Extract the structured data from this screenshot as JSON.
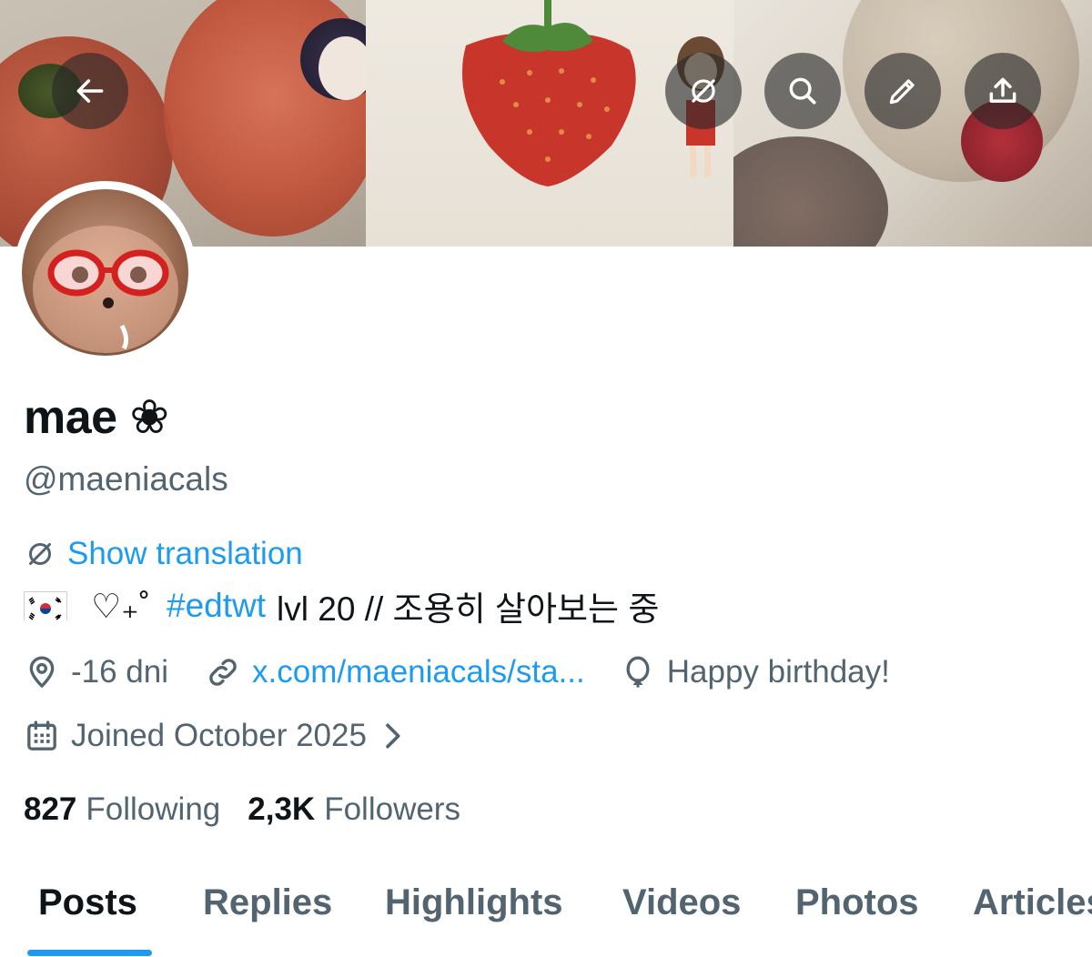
{
  "profile": {
    "display_name": "mae ❀",
    "handle": "@maeniacals",
    "translation_label": "Show translation",
    "bio": {
      "flag": "🇰🇷",
      "heart": "♡₊˚",
      "hashtag": "#edtwt",
      "text": "lvl 20 // 조용히 살아보는 중"
    },
    "location": "-16 dni",
    "website": "x.com/maeniacals/sta...",
    "birthday": "Happy birthday!",
    "joined": "Joined October 2025",
    "following_count": "827",
    "following_label": "Following",
    "followers_count": "2,3K",
    "followers_label": "Followers"
  },
  "header_actions": {
    "back": "arrow-left-icon",
    "translate": "translate-icon",
    "search": "search-icon",
    "edit": "pencil-icon",
    "share": "share-icon"
  },
  "tabs": [
    {
      "label": "Posts",
      "active": true
    },
    {
      "label": "Replies",
      "active": false
    },
    {
      "label": "Highlights",
      "active": false
    },
    {
      "label": "Videos",
      "active": false
    },
    {
      "label": "Photos",
      "active": false
    },
    {
      "label": "Articles",
      "active": false
    }
  ],
  "colors": {
    "accent": "#1d9bf0",
    "text_primary": "#0f1419",
    "text_secondary": "#536471"
  }
}
